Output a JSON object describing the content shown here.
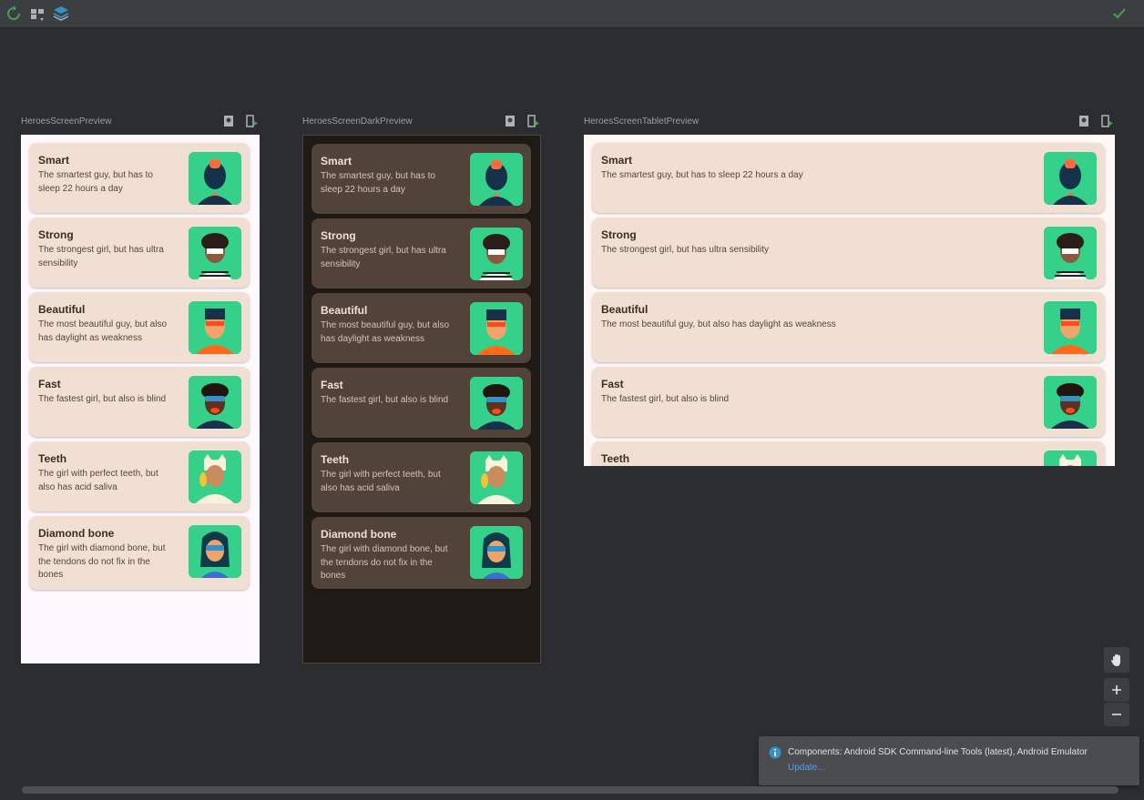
{
  "toolbar": {
    "icons": [
      "refresh-icon",
      "layout-icon",
      "layers-icon",
      "checkmark-icon"
    ],
    "accent_green": "#499c54",
    "accent_blue": "#3592c4"
  },
  "previews": [
    {
      "label": "HeroesScreenPreview",
      "theme": "light",
      "heroes": [
        {
          "name": "Smart",
          "desc1": "The smartest guy, but has to",
          "desc2": "sleep 22 hours a day",
          "desc3": ""
        },
        {
          "name": "Strong",
          "desc1": "The strongest girl, but has ultra",
          "desc2": "sensibility",
          "desc3": ""
        },
        {
          "name": "Beautiful",
          "desc1": "The most beautiful guy, but also",
          "desc2": "has daylight as weakness",
          "desc3": ""
        },
        {
          "name": "Fast",
          "desc1": "The fastest girl, but also is blind",
          "desc2": "",
          "desc3": ""
        },
        {
          "name": "Teeth",
          "desc1": "The girl with perfect teeth, but",
          "desc2": "also has acid saliva",
          "desc3": ""
        },
        {
          "name": "Diamond bone",
          "desc1": "The girl with diamond bone, but",
          "desc2": "the tendons do not fix in the",
          "desc3": "bones"
        }
      ]
    },
    {
      "label": "HeroesScreenDarkPreview",
      "theme": "dark",
      "heroes": [
        {
          "name": "Smart",
          "desc1": "The smartest guy, but has to",
          "desc2": "sleep 22 hours a day",
          "desc3": ""
        },
        {
          "name": "Strong",
          "desc1": "The strongest girl, but has ultra",
          "desc2": "sensibility",
          "desc3": ""
        },
        {
          "name": "Beautiful",
          "desc1": "The most beautiful guy, but also",
          "desc2": "has daylight as weakness",
          "desc3": ""
        },
        {
          "name": "Fast",
          "desc1": "The fastest girl, but also is blind",
          "desc2": "",
          "desc3": ""
        },
        {
          "name": "Teeth",
          "desc1": "The girl with perfect teeth, but",
          "desc2": "also has acid saliva",
          "desc3": ""
        },
        {
          "name": "Diamond bone",
          "desc1": "The girl with diamond bone, but",
          "desc2": "the tendons do not fix in the",
          "desc3": "bones"
        }
      ]
    },
    {
      "label": "HeroesScreenTabletPreview",
      "theme": "tablet",
      "heroes": [
        {
          "name": "Smart",
          "desc1": "The smartest guy, but has to sleep 22 hours a day"
        },
        {
          "name": "Strong",
          "desc1": "The strongest girl, but has ultra sensibility"
        },
        {
          "name": "Beautiful",
          "desc1": "The most beautiful guy, but also has daylight as weakness"
        },
        {
          "name": "Fast",
          "desc1": "The fastest girl, but also is blind"
        },
        {
          "name": "Teeth",
          "desc1": ""
        }
      ]
    }
  ],
  "preview_tool_icons": [
    "interactive-mode-icon",
    "deploy-to-device-icon"
  ],
  "side_tools": {
    "icons": [
      "pan-hand-icon",
      "zoom-in-icon",
      "zoom-out-icon"
    ]
  },
  "notification": {
    "text": "Components: Android SDK Command-line Tools (latest), Android Emulator",
    "link": "Update...",
    "icon": "info-icon"
  },
  "colors": {
    "light_card": "#f1dfd3",
    "dark_card": "#52433a",
    "dark_background": "#201a17",
    "avatar_background": "#35d18a"
  }
}
